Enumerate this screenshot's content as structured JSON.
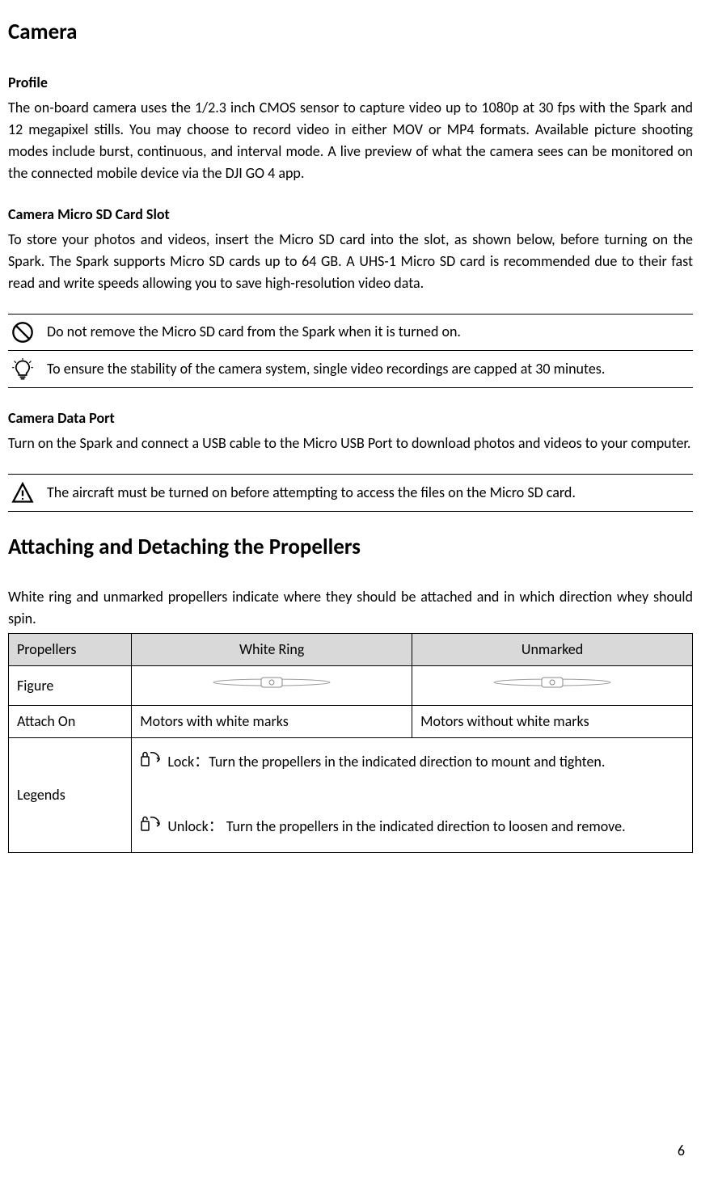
{
  "camera": {
    "heading": "Camera",
    "profile": {
      "title": "Profile",
      "text": "The on-board camera uses the 1/2.3 inch CMOS sensor to capture video up to 1080p at 30 fps with the Spark and 12 megapixel stills. You may choose to record video in either MOV or MP4 formats. Available picture shooting modes include burst, continuous, and interval mode. A live preview of what the camera sees can be monitored on the connected mobile device via the DJI GO 4 app."
    },
    "sd": {
      "title": "Camera Micro SD Card Slot",
      "text": "To store your photos and videos, insert the Micro SD card into the slot, as shown below, before turning on the Spark. The Spark supports Micro SD cards up to 64 GB. A UHS-1 Micro SD card is recommended due to their fast read and write speeds allowing you to save high-resolution video data."
    },
    "notes1": {
      "prohibit": "Do not remove the Micro SD card from the Spark when it is turned on.",
      "tip": "To ensure the stability of the camera system, single video recordings are capped at 30 minutes."
    },
    "dataport": {
      "title": "Camera Data Port",
      "text": "Turn on the Spark and connect a USB cable to the Micro USB Port to download photos and videos to your computer."
    },
    "notes2": {
      "warn": "The aircraft must be turned on before attempting to access the files on the Micro SD card."
    }
  },
  "propellers": {
    "heading": "Attaching and Detaching the Propellers",
    "intro": "White ring and unmarked propellers indicate where they should be attached and in which direction whey should spin.",
    "headers": {
      "col0": "Propellers",
      "col1": "White Ring",
      "col2": "Unmarked"
    },
    "rows": {
      "figure": "Figure",
      "attach": {
        "label": "Attach On",
        "white": "Motors with white marks",
        "unmarked": "Motors without white marks"
      },
      "legends": {
        "label": "Legends",
        "lock": "Lock：Turn the propellers in the indicated direction to mount and tighten.",
        "unlock": "Unlock： Turn the propellers in the indicated direction to loosen and remove."
      }
    }
  },
  "page_number": "6"
}
